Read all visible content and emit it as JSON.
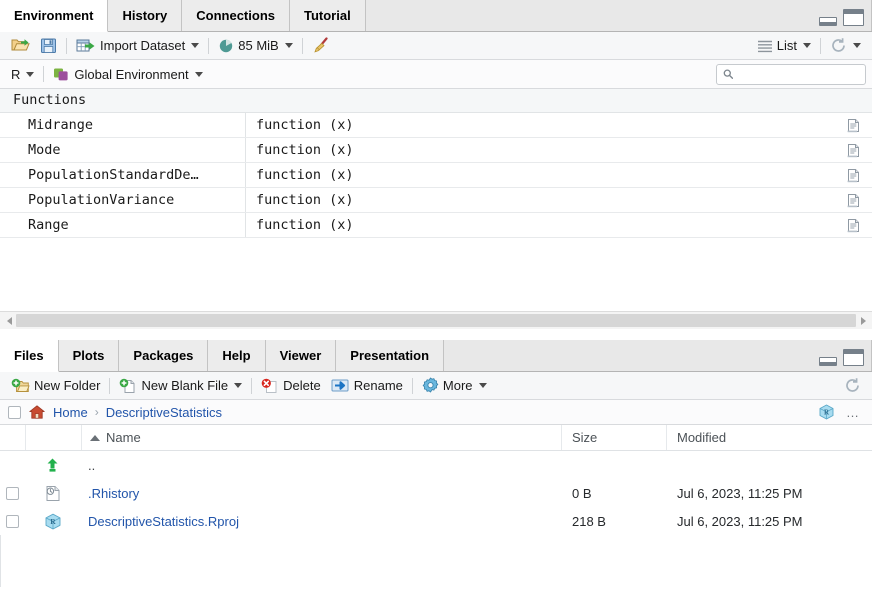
{
  "environment_panel": {
    "tabs": [
      {
        "label": "Environment",
        "active": true
      },
      {
        "label": "History",
        "active": false
      },
      {
        "label": "Connections",
        "active": false
      },
      {
        "label": "Tutorial",
        "active": false
      }
    ],
    "toolbar": {
      "open_icon": "open-folder-icon",
      "save_icon": "save-floppy-icon",
      "import_label": "Import Dataset",
      "import_icon": "import-dataset-icon",
      "memory_label": "85 MiB",
      "memory_icon": "memory-pie-icon",
      "broom_icon": "clear-objects-broom-icon",
      "view_label": "List",
      "view_icon": "list-view-icon",
      "refresh_icon": "refresh-icon"
    },
    "context_bar": {
      "language_label": "R",
      "scope_label": "Global Environment",
      "scope_icon": "global-environment-icon",
      "search_placeholder": "",
      "search_value": "",
      "search_icon": "search-icon"
    },
    "window_controls": {
      "minimize_icon": "minimize-icon",
      "maximize_icon": "maximize-icon"
    },
    "table": {
      "group_label": "Functions",
      "rows": [
        {
          "name": "Midrange",
          "value": "function (x)",
          "icon": "view-function-icon"
        },
        {
          "name": "Mode",
          "value": "function (x)",
          "icon": "view-function-icon"
        },
        {
          "name": "PopulationStandardDe…",
          "value": "function (x)",
          "icon": "view-function-icon"
        },
        {
          "name": "PopulationVariance",
          "value": "function (x)",
          "icon": "view-function-icon"
        },
        {
          "name": "Range",
          "value": "function (x)",
          "icon": "view-function-icon"
        }
      ]
    }
  },
  "files_panel": {
    "tabs": [
      {
        "label": "Files",
        "active": true
      },
      {
        "label": "Plots",
        "active": false
      },
      {
        "label": "Packages",
        "active": false
      },
      {
        "label": "Help",
        "active": false
      },
      {
        "label": "Viewer",
        "active": false
      },
      {
        "label": "Presentation",
        "active": false
      }
    ],
    "toolbar": {
      "new_folder_label": "New Folder",
      "new_folder_icon": "new-folder-icon",
      "new_blank_file_label": "New Blank File",
      "new_blank_file_icon": "new-blank-file-icon",
      "delete_label": "Delete",
      "delete_icon": "delete-icon",
      "rename_label": "Rename",
      "rename_icon": "rename-icon",
      "more_label": "More",
      "more_icon": "gear-icon",
      "refresh_icon": "refresh-icon"
    },
    "window_controls": {
      "minimize_icon": "minimize-icon",
      "maximize_icon": "maximize-icon"
    },
    "path_bar": {
      "home_icon": "home-icon",
      "crumbs": [
        "Home",
        "DescriptiveStatistics"
      ],
      "separator": "›",
      "project_icon": "r-project-icon",
      "overflow_label": "…"
    },
    "table": {
      "columns": {
        "name": "Name",
        "size": "Size",
        "modified": "Modified"
      },
      "rows": [
        {
          "icon": "parent-folder-up-icon",
          "name": "..",
          "size": "",
          "modified": "",
          "checkbox": false,
          "link": false
        },
        {
          "icon": "rhistory-file-icon",
          "name": ".Rhistory",
          "size": "0 B",
          "modified": "Jul 6, 2023, 11:25 PM",
          "checkbox": true,
          "link": true
        },
        {
          "icon": "r-project-icon",
          "name": "DescriptiveStatistics.Rproj",
          "size": "218 B",
          "modified": "Jul 6, 2023, 11:25 PM",
          "checkbox": true,
          "link": true
        }
      ]
    }
  }
}
